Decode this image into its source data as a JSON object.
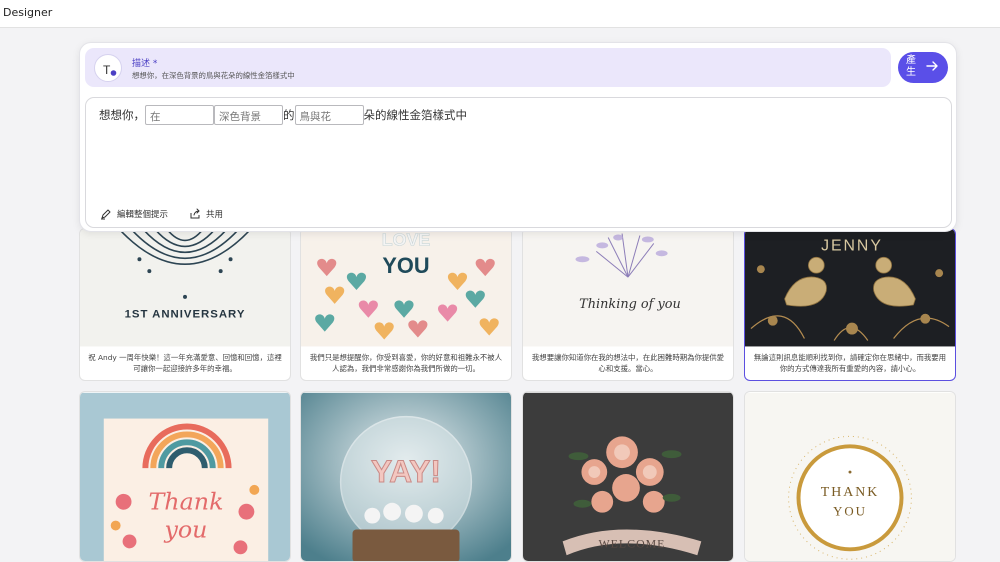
{
  "window": {
    "title": "Designer"
  },
  "prompt": {
    "label": "描述 *",
    "summary": "想想你，在深色背景的鳥與花朵的線性金箔樣式中",
    "generate_label": "產生",
    "template": {
      "part1": "想想你，",
      "slot1": "在",
      "slot2": "深色背景",
      "part2": "的",
      "slot3": "鳥與花",
      "part3": "朵的線性金箔樣式中"
    },
    "edit_label": "編輯整個提示",
    "share_label": "共用"
  },
  "cards": [
    {
      "title": "1ST ANNIVERSARY",
      "caption": "祝 Andy 一周年快樂！這一年充滿愛意、回憶和回憶，這裡可讓你一起迎接許多年的幸福。"
    },
    {
      "title": "LOVE YOU",
      "caption": "我們只是想提醒你，你受到喜愛，你的好意和祖難永不被人人認為，我們非常感謝你為我們所做的一切。"
    },
    {
      "title": "Thinking of you",
      "caption": "我想要讓你知道你在我的想法中，在此困難時期為你提供愛心和支援。當心。"
    },
    {
      "title": "JENNY",
      "caption": "無論這則訊息能順利找到你，請確定你在思緒中，而我要用你的方式傳達我所有重愛的內容，請小心。"
    },
    {
      "title": "Thank you",
      "caption": ""
    },
    {
      "title": "YAY!",
      "caption": ""
    },
    {
      "title": "WELCOME",
      "caption": ""
    },
    {
      "title": "THANK YOU",
      "caption": ""
    }
  ],
  "colors": {
    "accent": "#5a4fe8",
    "prompt_bar": "#ebe7fb",
    "selected_border": "#5b4fe0"
  }
}
